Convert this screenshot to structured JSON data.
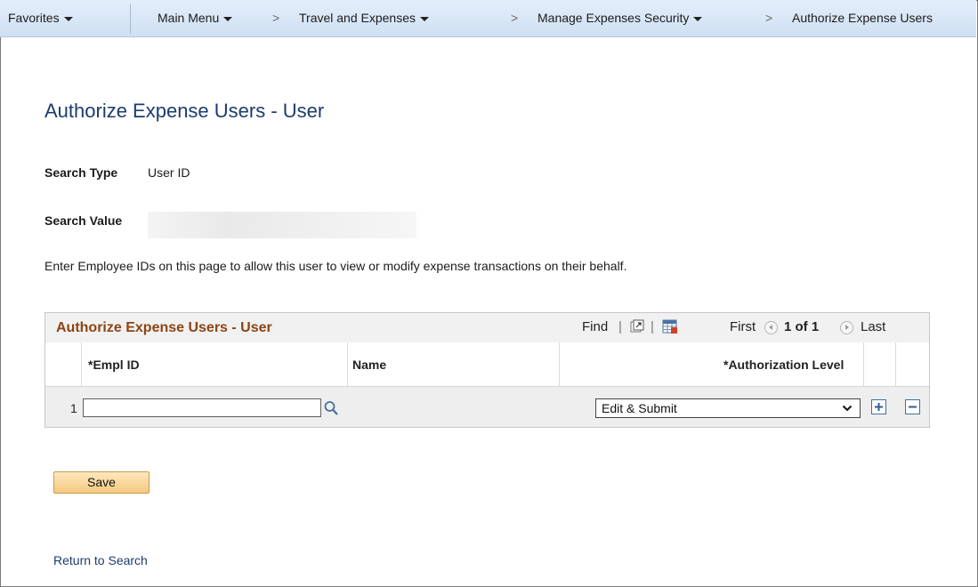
{
  "breadcrumb": {
    "favorites": "Favorites",
    "main_menu": "Main Menu",
    "travel": "Travel and Expenses",
    "manage_security": "Manage Expenses Security",
    "current": "Authorize Expense Users",
    "separator": ">"
  },
  "page": {
    "title": "Authorize Expense Users - User",
    "search_type_label": "Search Type",
    "search_type_value": "User ID",
    "search_value_label": "Search Value",
    "instructions": "Enter Employee IDs on this page to allow this user to view or modify expense transactions on their behalf."
  },
  "grid": {
    "title": "Authorize Expense Users - User",
    "find": "Find",
    "pipe": "|",
    "first": "First",
    "pager": "1 of 1",
    "last": "Last",
    "columns": {
      "empl_id": "*Empl ID",
      "name": "Name",
      "auth_level": "*Authorization Level"
    },
    "rows": [
      {
        "num": "1",
        "empl_id": "",
        "name": "",
        "auth_level": "Edit & Submit"
      }
    ]
  },
  "actions": {
    "save": "Save",
    "return_to_search": "Return to Search"
  },
  "colors": {
    "title_blue": "#1c3c6e",
    "grid_title_brown": "#8b4513",
    "save_gradient_top": "#fde8bd",
    "save_gradient_bottom": "#f5c980"
  }
}
